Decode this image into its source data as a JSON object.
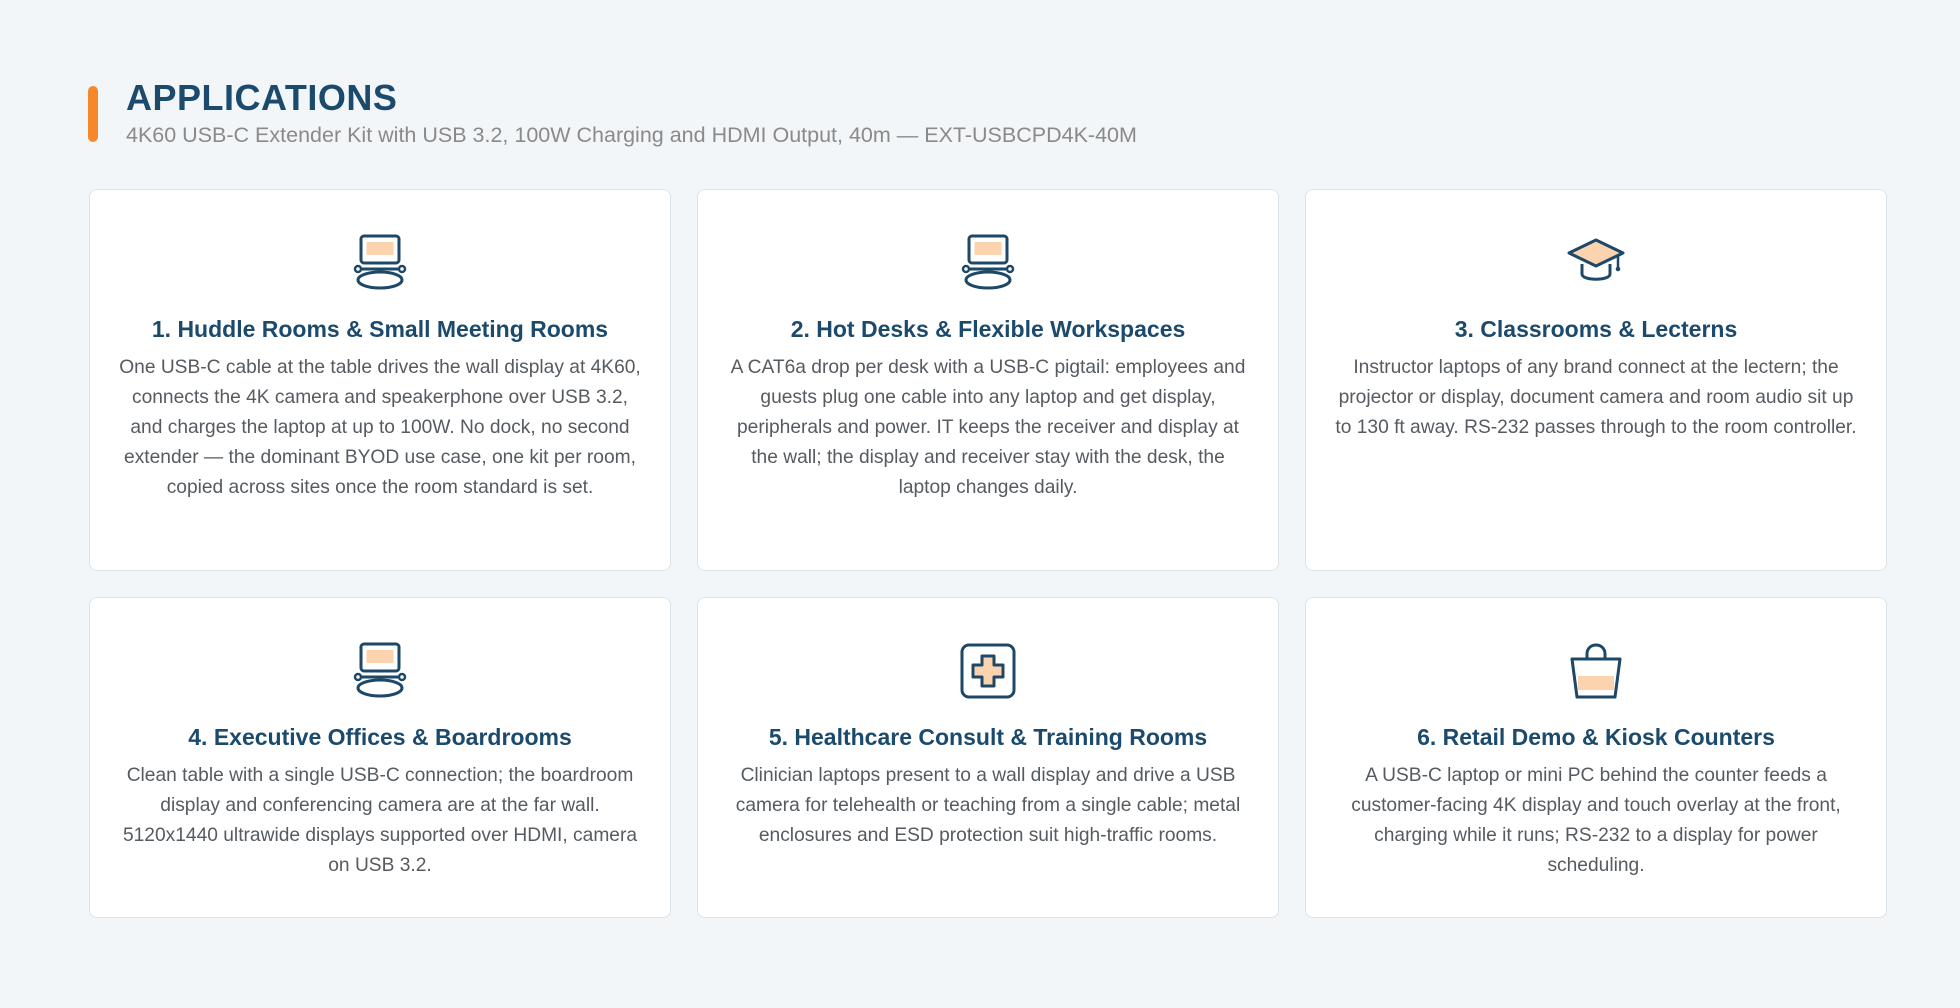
{
  "header": {
    "title": "APPLICATIONS",
    "subtitle": "4K60 USB-C Extender Kit with USB 3.2, 100W Charging and HDMI Output, 40m — EXT-USBCPD4K-40M"
  },
  "colors": {
    "accent": "#f5882a",
    "title": "#1b4a6d",
    "icon_stroke": "#1d4867",
    "icon_fill": "#fbd3ae",
    "body_text": "#555b60",
    "page_background": "#f2f6f9"
  },
  "cards": [
    {
      "icon": "laptop-on-table-icon",
      "title": "1. Huddle Rooms & Small Meeting Rooms",
      "text": "One USB-C cable at the table drives the wall display at 4K60, connects the 4K camera and speakerphone over USB 3.2, and charges the laptop at up to 100W. No dock, no second extender — the dominant BYOD use case, one kit per room, copied across sites once the room standard is set."
    },
    {
      "icon": "laptop-on-table-icon",
      "title": "2. Hot Desks & Flexible Workspaces",
      "text": "A CAT6a drop per desk with a USB-C pigtail: employees and guests plug one cable into any laptop and get display, peripherals and power. IT keeps the receiver and display at the wall; the display and receiver stay with the desk, the laptop changes daily."
    },
    {
      "icon": "graduation-cap-icon",
      "title": "3. Classrooms & Lecterns",
      "text": "Instructor laptops of any brand connect at the lectern; the projector or display, document camera and room audio sit up to 130 ft away. RS-232 passes through to the room controller."
    },
    {
      "icon": "laptop-on-table-icon",
      "title": "4. Executive Offices & Boardrooms",
      "text": "Clean table with a single USB-C connection; the boardroom display and conferencing camera are at the far wall. 5120x1440 ultrawide displays supported over HDMI, camera on USB 3.2."
    },
    {
      "icon": "medical-cross-icon",
      "title": "5. Healthcare Consult & Training Rooms",
      "text": "Clinician laptops present to a wall display and drive a USB camera for telehealth or teaching from a single cable; metal enclosures and ESD protection suit high-traffic rooms."
    },
    {
      "icon": "shopping-bag-icon",
      "title": "6. Retail Demo & Kiosk Counters",
      "text": "A USB-C laptop or mini PC behind the counter feeds a customer-facing 4K display and touch overlay at the front, charging while it runs; RS-232 to a display for power scheduling."
    }
  ]
}
